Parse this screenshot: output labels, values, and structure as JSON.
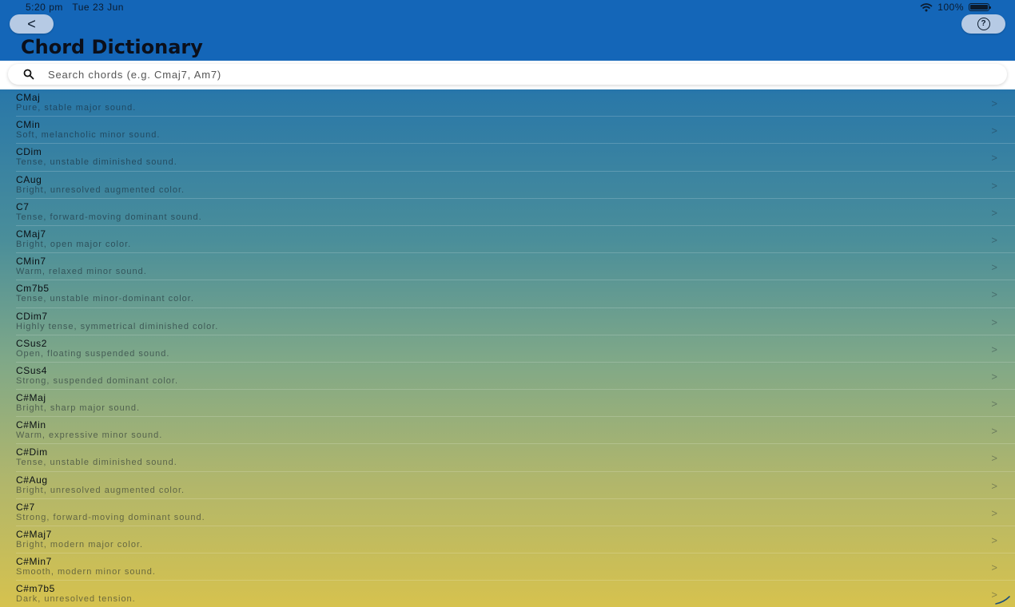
{
  "status_bar": {
    "time": "5:20 pm",
    "date": "Tue 23 Jun",
    "battery": "100%",
    "wifi_icon": "wifi-icon",
    "battery_icon": "battery-icon"
  },
  "header": {
    "back_label": "<",
    "title": "Chord Dictionary",
    "help_icon": "?"
  },
  "search": {
    "placeholder": "Search chords (e.g. Cmaj7, Am7)",
    "value": ""
  },
  "chords": [
    {
      "name": "CMaj",
      "desc": "Pure, stable major sound."
    },
    {
      "name": "CMin",
      "desc": "Soft, melancholic minor sound."
    },
    {
      "name": "CDim",
      "desc": "Tense, unstable diminished sound."
    },
    {
      "name": "CAug",
      "desc": "Bright, unresolved augmented color."
    },
    {
      "name": "C7",
      "desc": "Tense, forward-moving dominant sound."
    },
    {
      "name": "CMaj7",
      "desc": "Bright, open major color."
    },
    {
      "name": "CMin7",
      "desc": "Warm, relaxed minor sound."
    },
    {
      "name": "Cm7b5",
      "desc": "Tense, unstable minor-dominant color."
    },
    {
      "name": "CDim7",
      "desc": "Highly tense, symmetrical diminished color."
    },
    {
      "name": "CSus2",
      "desc": "Open, floating suspended sound."
    },
    {
      "name": "CSus4",
      "desc": "Strong, suspended dominant color."
    },
    {
      "name": "C#Maj",
      "desc": "Bright, sharp major sound."
    },
    {
      "name": "C#Min",
      "desc": "Warm, expressive minor sound."
    },
    {
      "name": "C#Dim",
      "desc": "Tense, unstable diminished sound."
    },
    {
      "name": "C#Aug",
      "desc": "Bright, unresolved augmented color."
    },
    {
      "name": "C#7",
      "desc": "Strong, forward-moving dominant sound."
    },
    {
      "name": "C#Maj7",
      "desc": "Bright, modern major color."
    },
    {
      "name": "C#Min7",
      "desc": "Smooth, modern minor sound."
    },
    {
      "name": "C#m7b5",
      "desc": "Dark, unresolved tension."
    }
  ],
  "chevron": ">"
}
